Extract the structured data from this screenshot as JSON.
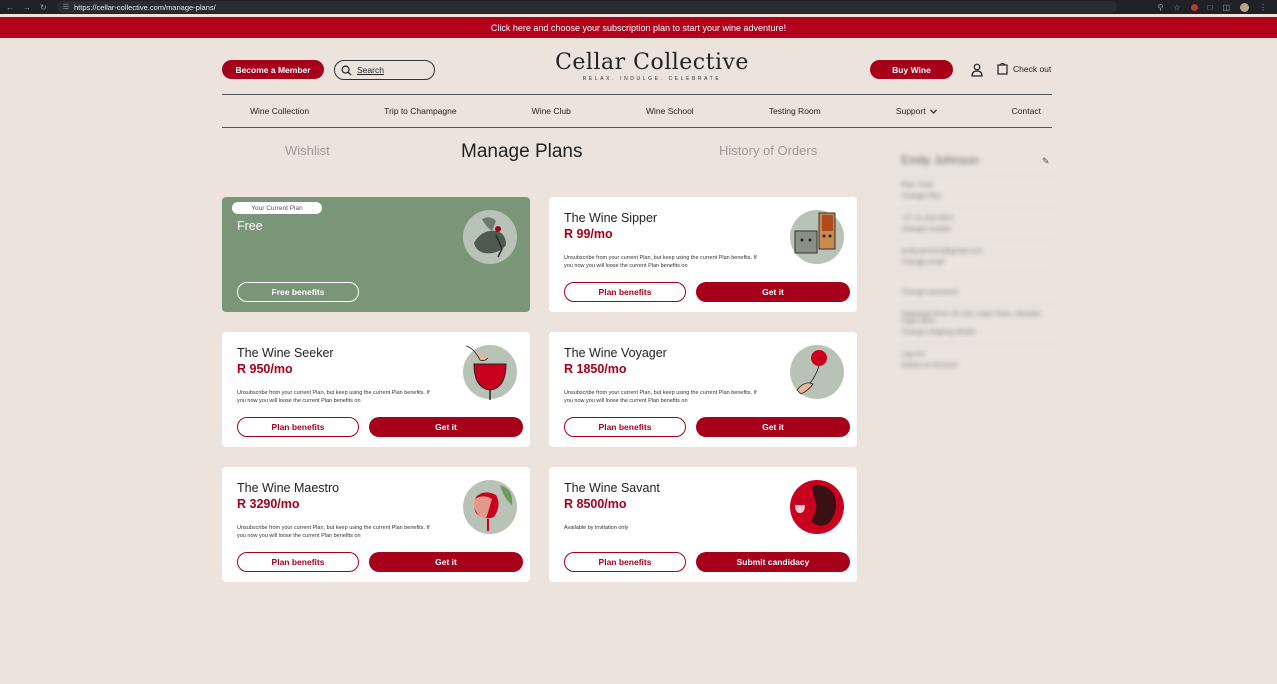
{
  "browser": {
    "url": "https://cellar-collective.com/manage-plans/"
  },
  "banner": {
    "text": "Click here and choose your subscription plan to start your wine adventure!"
  },
  "header": {
    "become_member_label": "Become a Member",
    "search_label": "Search",
    "logo_name": "Cellar Collective",
    "logo_tagline": "RELAX. INDULGE. CELEBRATE",
    "buy_wine_label": "Buy Wine",
    "checkout_label": "Check out"
  },
  "nav": {
    "items": [
      {
        "label": "Wine Collection"
      },
      {
        "label": "Trip to Champagne"
      },
      {
        "label": "Wine Club"
      },
      {
        "label": "Wine School"
      },
      {
        "label": "Testing Room"
      },
      {
        "label": "Support"
      },
      {
        "label": "Contact"
      }
    ]
  },
  "tabs": {
    "wishlist": "Wishlist",
    "manage_plans": "Manage Plans",
    "history": "History of Orders"
  },
  "plans": [
    {
      "badge": "Your Current Plan",
      "title": "Free",
      "benefits_label": "Free benefits",
      "current": true
    },
    {
      "title": "The Wine Sipper",
      "price": "R 99/mo",
      "desc": "Unsubscribe from your current Plan, but keep using the current Plan benefits. If you now you will loose the current Plan benefits on",
      "benefits_label": "Plan benefits",
      "action_label": "Get it"
    },
    {
      "title": "The Wine Seeker",
      "price": "R 950/mo",
      "desc": "Unsubscribe from your current Plan, but keep using the current Plan benefits. If you now you will loose the current Plan benefits on",
      "benefits_label": "Plan benefits",
      "action_label": "Get it"
    },
    {
      "title": "The Wine Voyager",
      "price": "R 1850/mo",
      "desc": "Unsubscribe from your current Plan, but keep using the current Plan benefits. If you now you will loose the current Plan benefits on",
      "benefits_label": "Plan benefits",
      "action_label": "Get it"
    },
    {
      "title": "The Wine Maestro",
      "price": "R 3290/mo",
      "desc": "Unsubscribe from your current Plan, but keep using the current Plan benefits. If you now you will loose the current Plan benefits on",
      "benefits_label": "Plan benefits",
      "action_label": "Get it"
    },
    {
      "title": "The Wine Savant",
      "price": "R 8500/mo",
      "desc": "Available by invitation only",
      "benefits_label": "Plan benefits",
      "action_label": "Submit candidacy"
    }
  ],
  "profile": {
    "name": "Emily Johnson",
    "lines": [
      "Plan: Free",
      "Change Plan",
      "+27 21 410 4822",
      "Change number",
      "emily.johnson@gmail.com",
      "Change email",
      "Change password",
      "Oakwood Drive 25-130, Cape Town, Western Cape 8001",
      "Change shipping details",
      "Log out",
      "Delete an Account"
    ]
  },
  "colors": {
    "accent": "#a7001b",
    "background": "#ece3dd",
    "current_plan": "#7a9577"
  }
}
